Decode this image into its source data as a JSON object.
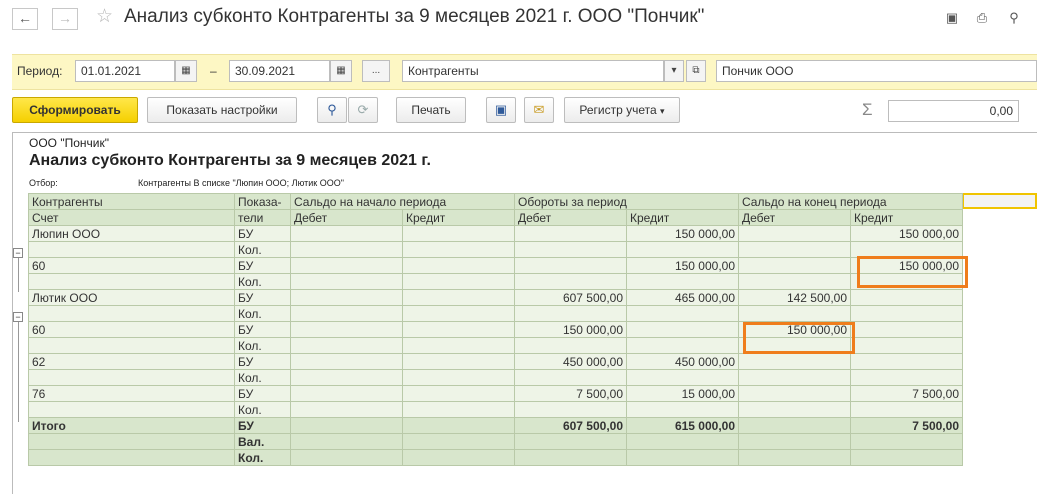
{
  "window": {
    "title": "Анализ субконто Контрагенты за 9 месяцев 2021 г. ООО \"Пончик\""
  },
  "filter": {
    "period_label": "Период:",
    "date_from": "01.01.2021",
    "dash": "–",
    "date_to": "30.09.2021",
    "more_label": "...",
    "subconto_type": "Контрагенты",
    "organization": "Пончик ООО"
  },
  "toolbar": {
    "generate_label": "Сформировать",
    "settings_label": "Показать настройки",
    "print_label": "Печать",
    "register_label": "Регистр учета",
    "sum_symbol": "Σ",
    "sum_value": "0,00"
  },
  "report": {
    "org": "ООО \"Пончик\"",
    "title": "Анализ субконто Контрагенты за 9 месяцев 2021 г.",
    "selection_label": "Отбор:",
    "selection_value": "Контрагенты В списке \"Люпин ООО; Лютик ООО\"",
    "headers": {
      "counterparties": "Контрагенты",
      "indicators_1": "Показа-",
      "indicators_2": "тели",
      "account": "Счет",
      "opening": "Сальдо на начало периода",
      "turnover": "Обороты за период",
      "closing": "Сальдо на конец периода",
      "debit": "Дебет",
      "credit": "Кредит"
    },
    "rows": [
      {
        "name": "Люпин ООО",
        "ind": "БУ",
        "c1": "",
        "c2": "",
        "c3": "",
        "c4": "150 000,00",
        "c5": "",
        "c6": "150 000,00"
      },
      {
        "name": "",
        "ind": "Кол.",
        "c1": "",
        "c2": "",
        "c3": "",
        "c4": "",
        "c5": "",
        "c6": ""
      },
      {
        "name": " 60",
        "ind": "БУ",
        "c1": "",
        "c2": "",
        "c3": "",
        "c4": "150 000,00",
        "c5": "",
        "c6": "150 000,00"
      },
      {
        "name": "",
        "ind": "Кол.",
        "c1": "",
        "c2": "",
        "c3": "",
        "c4": "",
        "c5": "",
        "c6": ""
      },
      {
        "name": "Лютик ООО",
        "ind": "БУ",
        "c1": "",
        "c2": "",
        "c3": "607 500,00",
        "c4": "465 000,00",
        "c5": "142 500,00",
        "c6": ""
      },
      {
        "name": "",
        "ind": "Кол.",
        "c1": "",
        "c2": "",
        "c3": "",
        "c4": "",
        "c5": "",
        "c6": ""
      },
      {
        "name": " 60",
        "ind": "БУ",
        "c1": "",
        "c2": "",
        "c3": "150 000,00",
        "c4": "",
        "c5": "150 000,00",
        "c6": ""
      },
      {
        "name": "",
        "ind": "Кол.",
        "c1": "",
        "c2": "",
        "c3": "",
        "c4": "",
        "c5": "",
        "c6": ""
      },
      {
        "name": " 62",
        "ind": "БУ",
        "c1": "",
        "c2": "",
        "c3": "450 000,00",
        "c4": "450 000,00",
        "c5": "",
        "c6": ""
      },
      {
        "name": "",
        "ind": "Кол.",
        "c1": "",
        "c2": "",
        "c3": "",
        "c4": "",
        "c5": "",
        "c6": ""
      },
      {
        "name": " 76",
        "ind": "БУ",
        "c1": "",
        "c2": "",
        "c3": "7 500,00",
        "c4": "15 000,00",
        "c5": "",
        "c6": "7 500,00"
      },
      {
        "name": "",
        "ind": "Кол.",
        "c1": "",
        "c2": "",
        "c3": "",
        "c4": "",
        "c5": "",
        "c6": ""
      }
    ],
    "total": [
      {
        "name": "Итого",
        "ind": "БУ",
        "c1": "",
        "c2": "",
        "c3": "607 500,00",
        "c4": "615 000,00",
        "c5": "",
        "c6": "7 500,00"
      },
      {
        "name": "",
        "ind": "Вал.",
        "c1": "",
        "c2": "",
        "c3": "",
        "c4": "",
        "c5": "",
        "c6": ""
      },
      {
        "name": "",
        "ind": "Кол.",
        "c1": "",
        "c2": "",
        "c3": "",
        "c4": "",
        "c5": "",
        "c6": ""
      }
    ]
  }
}
